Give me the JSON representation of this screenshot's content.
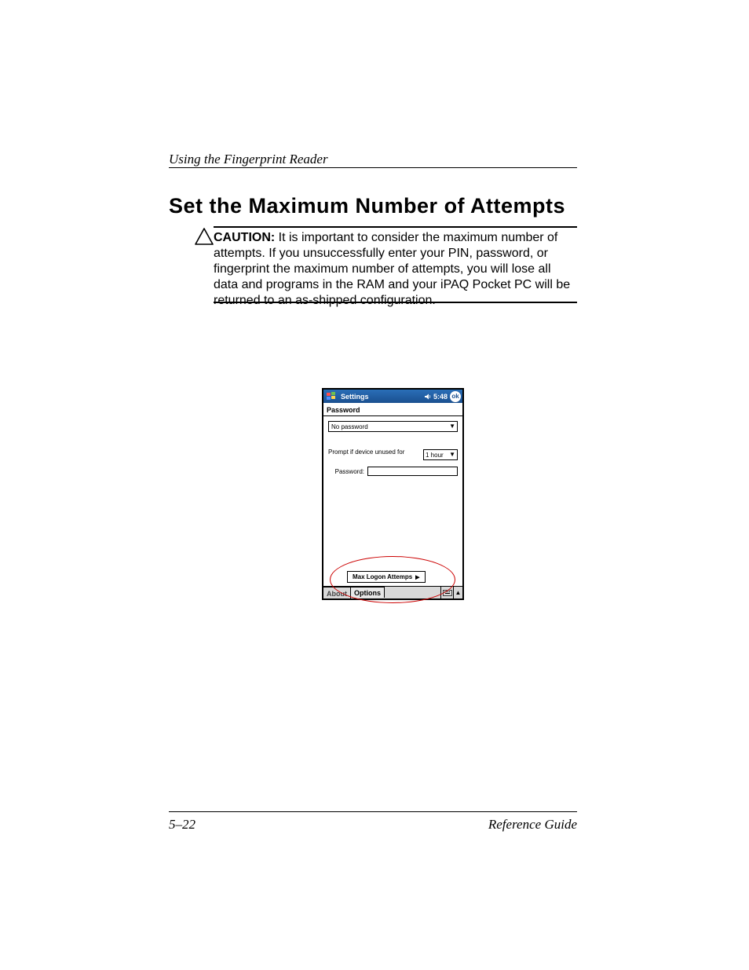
{
  "header": {
    "running_head": "Using the Fingerprint Reader"
  },
  "main": {
    "heading": "Set the Maximum Number of Attempts",
    "caution_label": "CAUTION:",
    "caution_body": " It is important to consider the maximum number of attempts. If you unsuccessfully enter your PIN, password, or fingerprint the maximum number of attempts, you will lose all data and programs in the RAM and your iPAQ Pocket PC will be returned to an as-shipped configuration."
  },
  "device": {
    "titlebar": {
      "title": "Settings",
      "time": "5:48",
      "ok": "ok"
    },
    "app_label": "Password",
    "type_select": "No password",
    "prompt_label": "Prompt if device unused for",
    "time_select": "1 hour",
    "password_label": "Password:",
    "popup_label": "Max Logon Attemps",
    "tabs": {
      "about": "About",
      "options": "Options"
    }
  },
  "footer": {
    "page": "5–22",
    "title": "Reference Guide"
  }
}
